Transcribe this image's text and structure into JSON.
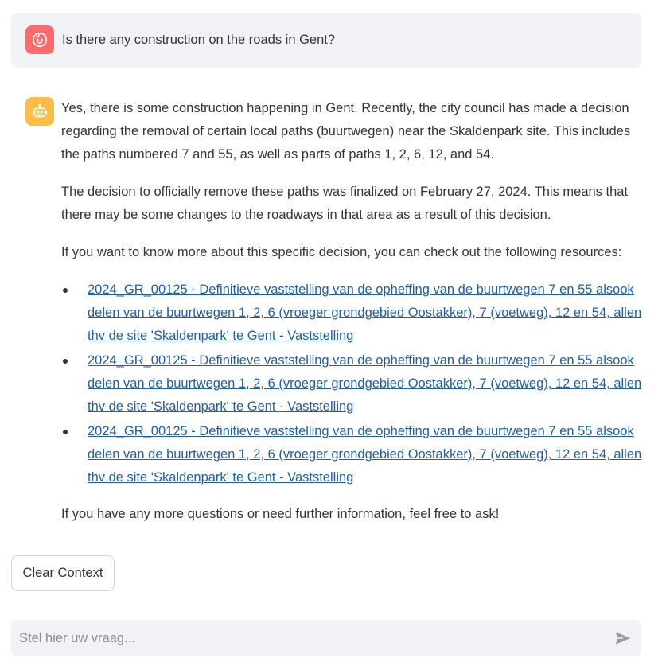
{
  "user_message": {
    "text": "Is there any construction on the roads in Gent?",
    "avatar_icon": "user-face-icon",
    "avatar_color": "#ff6b6b"
  },
  "assistant_message": {
    "avatar_icon": "robot-icon",
    "avatar_color": "#ffbd45",
    "paragraphs": [
      "Yes, there is some construction happening in Gent. Recently, the city council has made a decision regarding the removal of certain local paths (buurtwegen) near the Skaldenpark site. This includes the paths numbered 7 and 55, as well as parts of paths 1, 2, 6, 12, and 54.",
      "The decision to officially remove these paths was finalized on February 27, 2024. This means that there may be some changes to the roadways in that area as a result of this decision.",
      "If you want to know more about this specific decision, you can check out the following resources:"
    ],
    "links": [
      "2024_GR_00125 - Definitieve vaststelling van de opheffing van de buurtwegen 7 en 55 alsook delen van de buurtwegen 1, 2, 6 (vroeger grondgebied Oostakker), 7 (voetweg), 12 en 54, allen thv de site 'Skaldenpark' te Gent - Vaststelling",
      "2024_GR_00125 - Definitieve vaststelling van de opheffing van de buurtwegen 7 en 55 alsook delen van de buurtwegen 1, 2, 6 (vroeger grondgebied Oostakker), 7 (voetweg), 12 en 54, allen thv de site 'Skaldenpark' te Gent - Vaststelling",
      "2024_GR_00125 - Definitieve vaststelling van de opheffing van de buurtwegen 7 en 55 alsook delen van de buurtwegen 1, 2, 6 (vroeger grondgebied Oostakker), 7 (voetweg), 12 en 54, allen thv de site 'Skaldenpark' te Gent - Vaststelling"
    ],
    "closing": "If you have any more questions or need further information, feel free to ask!",
    "link_color": "#1f5fa8"
  },
  "controls": {
    "clear_button_label": "Clear Context",
    "chat_input_placeholder": "Stel hier uw vraag...",
    "chat_input_value": "",
    "send_icon": "send-arrow-icon"
  }
}
